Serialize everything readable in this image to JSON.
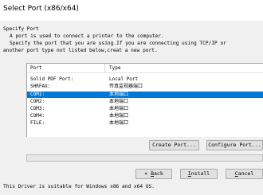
{
  "window": {
    "title": "Select Port (x86/x64)"
  },
  "intro": {
    "heading": "Specify Port",
    "line1": "A port is used to connect a printer to the computer.",
    "line2": "Specify the port that you are using.If you are connecting using TCP/IP or",
    "line3": "another port type not listed below,creat a new port."
  },
  "port_list": {
    "columns": [
      "Port",
      "Type"
    ],
    "rows": [
      {
        "port": "Solid PDF Port:",
        "type": "Local Port",
        "selected": false
      },
      {
        "port": "SHRFAX:",
        "type": "传真监视器端口",
        "selected": false
      },
      {
        "port": "COM1:",
        "type": "本地端口",
        "selected": true
      },
      {
        "port": "COM2:",
        "type": "本地端口",
        "selected": false
      },
      {
        "port": "COM3:",
        "type": "本地端口",
        "selected": false
      },
      {
        "port": "COM4:",
        "type": "本地端口",
        "selected": false
      },
      {
        "port": "FILE:",
        "type": "本地端口",
        "selected": false
      }
    ]
  },
  "buttons": {
    "create_port": "Create Port...",
    "configure_port": "Configure Port...",
    "back_prefix": "< ",
    "back_mnemonic": "B",
    "back_rest": "ack",
    "install_mnemonic": "I",
    "install_rest": "nstall",
    "cancel_mnemonic": "C",
    "cancel_rest": "ancel"
  },
  "progress": {
    "value": 0
  },
  "footer": {
    "text": "This Driver is suitable for Windows x86 and x64 OS."
  },
  "colors": {
    "selection": "#0078d7",
    "window_bg": "#f0f0f0"
  }
}
